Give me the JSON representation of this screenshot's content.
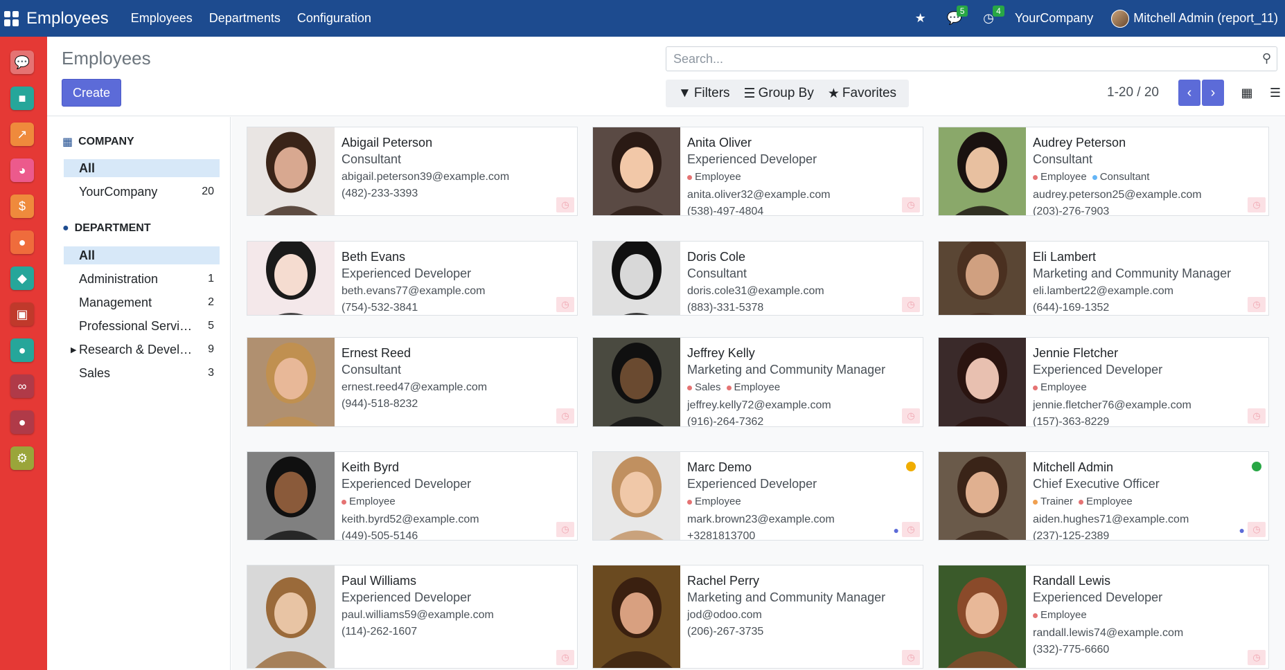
{
  "topbar": {
    "app_name": "Employees",
    "menus": [
      "Employees",
      "Departments",
      "Configuration"
    ],
    "chat_count": "5",
    "activity_count": "4",
    "company": "YourCompany",
    "user": "Mitchell Admin (report_11)"
  },
  "control_panel": {
    "title": "Employees",
    "create_label": "Create",
    "search_placeholder": "Search...",
    "filters_label": "Filters",
    "groupby_label": "Group By",
    "favorites_label": "Favorites",
    "pager": "1-20 / 20"
  },
  "sidebar": {
    "company_heading": "COMPANY",
    "company_items": [
      {
        "label": "All",
        "count": ""
      },
      {
        "label": "YourCompany",
        "count": "20"
      }
    ],
    "department_heading": "DEPARTMENT",
    "department_items": [
      {
        "label": "All",
        "count": ""
      },
      {
        "label": "Administration",
        "count": "1"
      },
      {
        "label": "Management",
        "count": "2"
      },
      {
        "label": "Professional Services",
        "count": "5"
      },
      {
        "label": "Research & Development",
        "count": "9"
      },
      {
        "label": "Sales",
        "count": "3"
      }
    ]
  },
  "colors": {
    "topbar": "#1d4b8f",
    "leftbar": "#e53935",
    "primary": "#5c6bd8",
    "status_away": "#f0ad00",
    "status_online": "#28a745"
  },
  "employees": [
    {
      "name": "Abigail Peterson",
      "job": "Consultant",
      "tags": [],
      "email": "abigail.peterson39@example.com",
      "phone": "(482)-233-3393"
    },
    {
      "name": "Anita Oliver",
      "job": "Experienced Developer",
      "tags": [
        {
          "label": "Employee",
          "color": "#e57373"
        }
      ],
      "email": "anita.oliver32@example.com",
      "phone": "(538)-497-4804"
    },
    {
      "name": "Audrey Peterson",
      "job": "Consultant",
      "tags": [
        {
          "label": "Employee",
          "color": "#e57373"
        },
        {
          "label": "Consultant",
          "color": "#64b5f6"
        }
      ],
      "email": "audrey.peterson25@example.com",
      "phone": "(203)-276-7903"
    },
    {
      "name": "Beth Evans",
      "job": "Experienced Developer",
      "tags": [],
      "email": "beth.evans77@example.com",
      "phone": "(754)-532-3841"
    },
    {
      "name": "Doris Cole",
      "job": "Consultant",
      "tags": [],
      "email": "doris.cole31@example.com",
      "phone": "(883)-331-5378"
    },
    {
      "name": "Eli Lambert",
      "job": "Marketing and Community Manager",
      "tags": [],
      "email": "eli.lambert22@example.com",
      "phone": "(644)-169-1352"
    },
    {
      "name": "Ernest Reed",
      "job": "Consultant",
      "tags": [],
      "email": "ernest.reed47@example.com",
      "phone": "(944)-518-8232"
    },
    {
      "name": "Jeffrey Kelly",
      "job": "Marketing and Community Manager",
      "tags": [
        {
          "label": "Sales",
          "color": "#e57373"
        },
        {
          "label": "Employee",
          "color": "#e57373"
        }
      ],
      "email": "jeffrey.kelly72@example.com",
      "phone": "(916)-264-7362"
    },
    {
      "name": "Jennie Fletcher",
      "job": "Experienced Developer",
      "tags": [
        {
          "label": "Employee",
          "color": "#e57373"
        }
      ],
      "email": "jennie.fletcher76@example.com",
      "phone": "(157)-363-8229"
    },
    {
      "name": "Keith Byrd",
      "job": "Experienced Developer",
      "tags": [
        {
          "label": "Employee",
          "color": "#e57373"
        }
      ],
      "email": "keith.byrd52@example.com",
      "phone": "(449)-505-5146"
    },
    {
      "name": "Marc Demo",
      "job": "Experienced Developer",
      "tags": [
        {
          "label": "Employee",
          "color": "#e57373"
        }
      ],
      "email": "mark.brown23@example.com",
      "phone": "+3281813700",
      "status": "away",
      "chat": true
    },
    {
      "name": "Mitchell Admin",
      "job": "Chief Executive Officer",
      "tags": [
        {
          "label": "Trainer",
          "color": "#f0a050"
        },
        {
          "label": "Employee",
          "color": "#e57373"
        }
      ],
      "email": "aiden.hughes71@example.com",
      "phone": "(237)-125-2389",
      "status": "online",
      "chat": true
    },
    {
      "name": "Paul Williams",
      "job": "Experienced Developer",
      "tags": [],
      "email": "paul.williams59@example.com",
      "phone": "(114)-262-1607"
    },
    {
      "name": "Rachel Perry",
      "job": "Marketing and Community Manager",
      "tags": [],
      "email": "jod@odoo.com",
      "phone": "(206)-267-3735"
    },
    {
      "name": "Randall Lewis",
      "job": "Experienced Developer",
      "tags": [
        {
          "label": "Employee",
          "color": "#e57373"
        }
      ],
      "email": "randall.lewis74@example.com",
      "phone": "(332)-775-6660"
    }
  ]
}
